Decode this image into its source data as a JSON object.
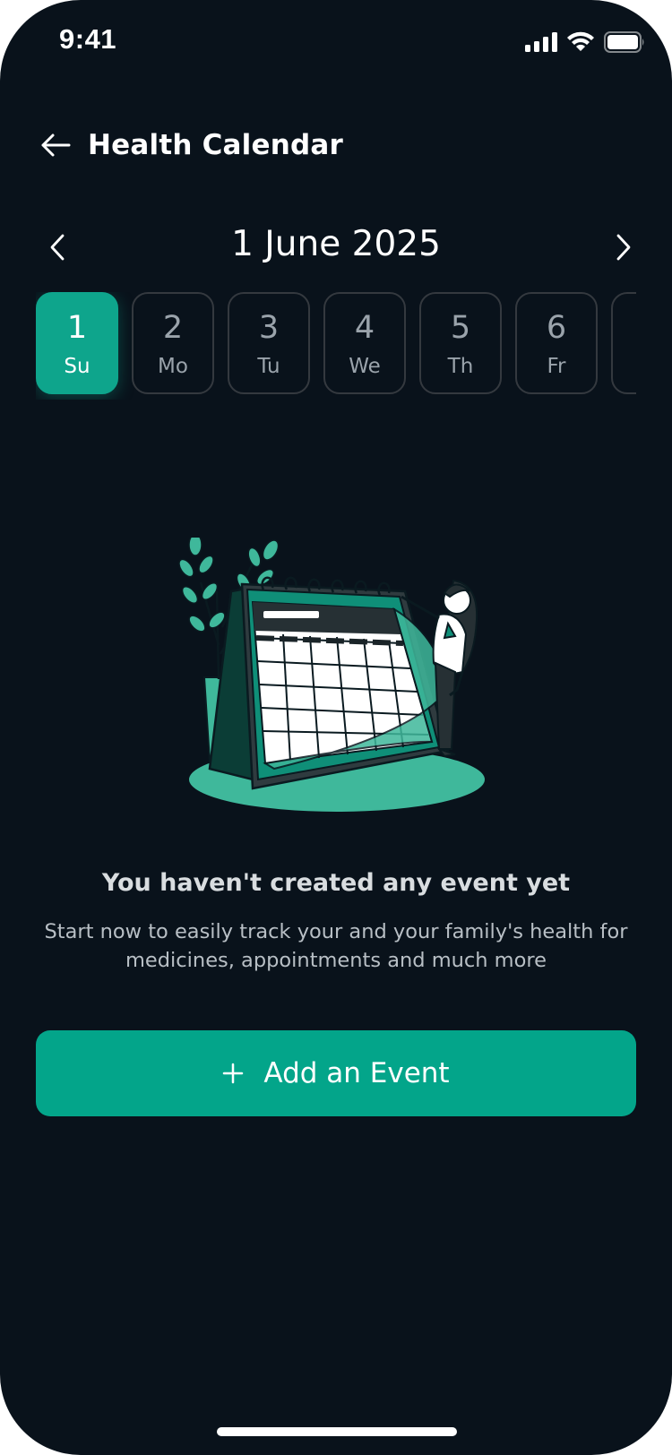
{
  "status_bar": {
    "time": "9:41",
    "icons": [
      "cellular-signal-icon",
      "wifi-icon",
      "battery-icon"
    ]
  },
  "header": {
    "back_icon": "arrow-left-icon",
    "title": "Health Calendar"
  },
  "month_nav": {
    "prev_icon": "chevron-left-icon",
    "title": "1 June 2025",
    "next_icon": "chevron-right-icon"
  },
  "days": [
    {
      "num": "1",
      "name": "Su",
      "selected": true
    },
    {
      "num": "2",
      "name": "Mo",
      "selected": false
    },
    {
      "num": "3",
      "name": "Tu",
      "selected": false
    },
    {
      "num": "4",
      "name": "We",
      "selected": false
    },
    {
      "num": "5",
      "name": "Th",
      "selected": false
    },
    {
      "num": "6",
      "name": "Fr",
      "selected": false
    },
    {
      "num": "",
      "name": "",
      "selected": false
    }
  ],
  "empty_state": {
    "illustration": "calendar-with-woman-and-plant-illustration",
    "title": "You haven't created any event yet",
    "description": "Start now to easily track your and your family's health for medicines, appointments  and much more"
  },
  "add_button": {
    "icon": "plus-icon",
    "label": "Add an Event"
  },
  "colors": {
    "background": "#09121b",
    "accent": "#03a58a",
    "day_border": "#34393f",
    "muted_text": "#9aa3ab"
  }
}
